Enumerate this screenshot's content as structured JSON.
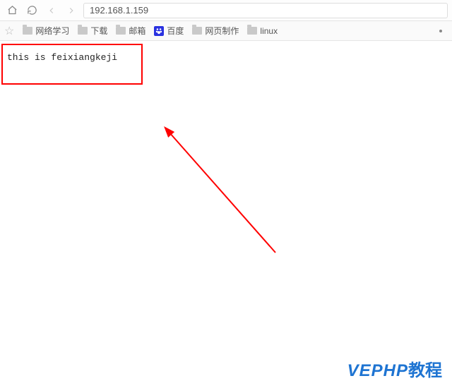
{
  "toolbar": {
    "address": "192.168.1.159"
  },
  "bookmarks": {
    "items": [
      {
        "label": "网络学习",
        "icon": "folder"
      },
      {
        "label": "下载",
        "icon": "folder"
      },
      {
        "label": "邮箱",
        "icon": "folder"
      },
      {
        "label": "百度",
        "icon": "baidu"
      },
      {
        "label": "网页制作",
        "icon": "folder"
      },
      {
        "label": "linux",
        "icon": "folder"
      }
    ]
  },
  "content": {
    "box_text": "this is feixiangkeji"
  },
  "watermark": {
    "part1": "VEPHP",
    "part2": "教程"
  }
}
